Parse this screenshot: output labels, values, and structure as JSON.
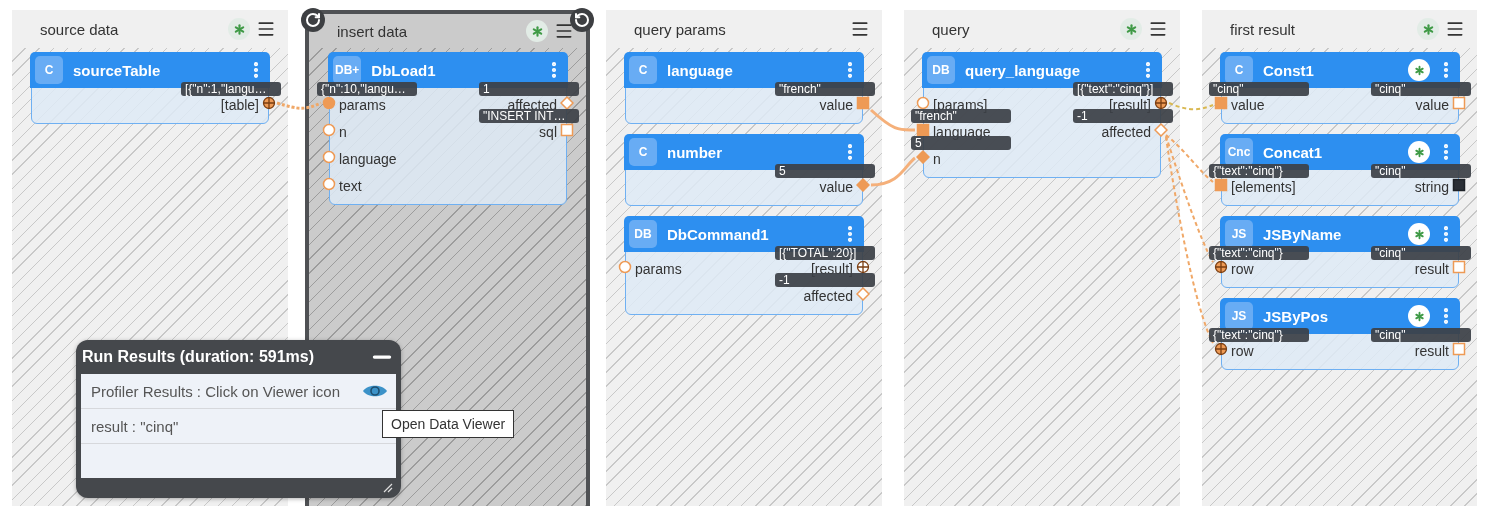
{
  "columns": [
    {
      "title": "source data",
      "selected": false,
      "asterisk": true,
      "nodes": [
        {
          "badge": "C",
          "name": "sourceTable",
          "asterisk": false,
          "rows": [
            {
              "right": {
                "label": "[table]",
                "kind": "table",
                "connected": true,
                "value": "[{\"n\":1,\"langu…"
              }
            }
          ]
        }
      ]
    },
    {
      "title": "insert data",
      "selected": true,
      "asterisk": true,
      "nodes": [
        {
          "badge": "DB+",
          "name": "DbLoad1",
          "asterisk": false,
          "rows": [
            {
              "left": {
                "label": "params",
                "kind": "object",
                "connected": true,
                "value": "{\"n\":10,\"langu…"
              },
              "right": {
                "label": "affected",
                "kind": "number",
                "connected": false,
                "value": "1"
              }
            },
            {
              "left": {
                "label": "n",
                "kind": "object",
                "connected": false
              },
              "right": {
                "label": "sql",
                "kind": "value",
                "connected": false,
                "value": "\"INSERT INT…"
              }
            },
            {
              "left": {
                "label": "language",
                "kind": "object",
                "connected": false
              }
            },
            {
              "left": {
                "label": "text",
                "kind": "object",
                "connected": false
              }
            }
          ]
        }
      ]
    },
    {
      "title": "query params",
      "selected": false,
      "asterisk": false,
      "nodes": [
        {
          "badge": "C",
          "name": "language",
          "asterisk": false,
          "rows": [
            {
              "right": {
                "label": "value",
                "kind": "value",
                "connected": true,
                "value": "\"french\""
              }
            }
          ]
        },
        {
          "badge": "C",
          "name": "number",
          "asterisk": false,
          "rows": [
            {
              "right": {
                "label": "value",
                "kind": "number",
                "connected": true,
                "value": "5"
              }
            }
          ]
        },
        {
          "badge": "DB",
          "name": "DbCommand1",
          "asterisk": false,
          "rows": [
            {
              "left": {
                "label": "params",
                "kind": "object",
                "connected": false
              },
              "right": {
                "label": "[result]",
                "kind": "table",
                "connected": false,
                "value": "[{\"TOTAL\":20}]"
              }
            },
            {
              "right": {
                "label": "affected",
                "kind": "number",
                "connected": false,
                "value": "-1"
              }
            }
          ]
        }
      ]
    },
    {
      "title": "query",
      "selected": false,
      "asterisk": true,
      "nodes": [
        {
          "badge": "DB",
          "name": "query_language",
          "asterisk": false,
          "rows": [
            {
              "left": {
                "label": "[params]",
                "kind": "object",
                "connected": false
              },
              "right": {
                "label": "[result]",
                "kind": "table",
                "connected": true,
                "value": "[{\"text\":\"cinq\"}]"
              }
            },
            {
              "left": {
                "label": "language",
                "kind": "value",
                "connected": true,
                "value": "\"french\""
              },
              "right": {
                "label": "affected",
                "kind": "number",
                "connected": false,
                "value": "-1"
              }
            },
            {
              "left": {
                "label": "n",
                "kind": "number",
                "connected": true,
                "value": "5"
              }
            }
          ]
        }
      ]
    },
    {
      "title": "first result",
      "selected": false,
      "asterisk": true,
      "nodes": [
        {
          "badge": "C",
          "name": "Const1",
          "asterisk": true,
          "rows": [
            {
              "left": {
                "label": "value",
                "kind": "value",
                "connected": true,
                "value": "\"cinq\""
              },
              "right": {
                "label": "value",
                "kind": "value",
                "connected": false,
                "value": "\"cinq\""
              }
            }
          ]
        },
        {
          "badge": "Cnc",
          "name": "Concat1",
          "asterisk": true,
          "rows": [
            {
              "left": {
                "label": "[elements]",
                "kind": "value",
                "connected": true,
                "value": "{\"text\":\"cinq\"}"
              },
              "right": {
                "label": "string",
                "kind": "text",
                "connected": false,
                "value": "\"cinq\""
              }
            }
          ]
        },
        {
          "badge": "JS",
          "name": "JSByName",
          "asterisk": true,
          "rows": [
            {
              "left": {
                "label": "row",
                "kind": "table",
                "connected": true,
                "value": "{\"text\":\"cinq\"}"
              },
              "right": {
                "label": "result",
                "kind": "value",
                "connected": false,
                "value": "\"cinq\""
              }
            }
          ]
        },
        {
          "badge": "JS",
          "name": "JSByPos",
          "asterisk": true,
          "rows": [
            {
              "left": {
                "label": "row",
                "kind": "table",
                "connected": true,
                "value": "{\"text\":\"cinq\"}"
              },
              "right": {
                "label": "result",
                "kind": "value",
                "connected": false,
                "value": "\"cinq\""
              }
            }
          ]
        }
      ]
    }
  ],
  "run_results": {
    "title": "Run Results (duration: 591ms)",
    "rows": [
      {
        "kind": "viewer",
        "text": "Profiler Results : Click on Viewer icon"
      },
      {
        "kind": "text",
        "text": "result : \"cinq\""
      }
    ]
  },
  "tooltip": "Open Data Viewer"
}
